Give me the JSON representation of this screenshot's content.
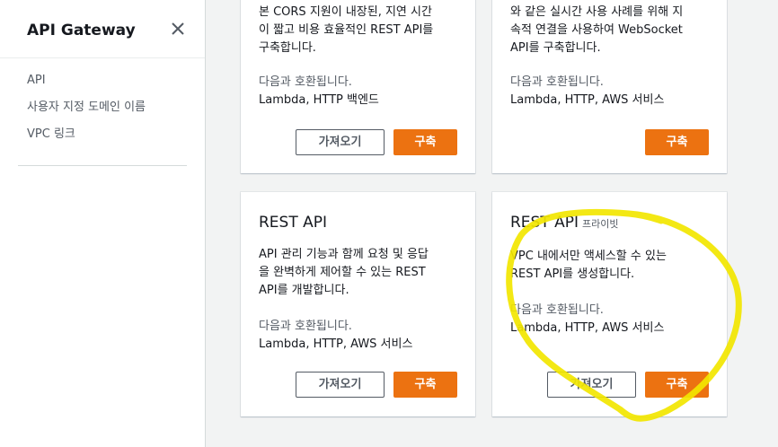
{
  "sidebar": {
    "title": "API Gateway",
    "close_icon": "close-icon",
    "items": [
      {
        "label": "API"
      },
      {
        "label": "사용자 지정 도메인 이름"
      },
      {
        "label": "VPC 링크"
      }
    ]
  },
  "cards": {
    "http_api": {
      "desc_lines": [
        "본 CORS 지원이 내장된, 지연 시간",
        "이 짧고 비용 효율적인 REST API를",
        "구축합니다."
      ],
      "compat_label": "다음과 호환됩니다.",
      "compat_value": "Lambda, HTTP 백엔드",
      "import_label": "가져오기",
      "build_label": "구축"
    },
    "websocket_api": {
      "desc_lines": [
        "와 같은 실시간 사용 사례를 위해 지",
        "속적 연결을 사용하여 WebSocket",
        "API를 구축합니다."
      ],
      "compat_label": "다음과 호환됩니다.",
      "compat_value": "Lambda, HTTP, AWS 서비스",
      "build_label": "구축"
    },
    "rest_api": {
      "title": "REST API",
      "desc_lines": [
        "API 관리 기능과 함께 요청 및 응답",
        "을 완벽하게 제어할 수 있는 REST",
        "API를 개발합니다."
      ],
      "compat_label": "다음과 호환됩니다.",
      "compat_value": "Lambda, HTTP, AWS 서비스",
      "import_label": "가져오기",
      "build_label": "구축"
    },
    "rest_api_private": {
      "title": "REST API",
      "badge": "프라이빗",
      "desc_lines": [
        "VPC 내에서만 액세스할 수 있는",
        "REST API를 생성합니다."
      ],
      "compat_label": "다음과 호환됩니다.",
      "compat_value": "Lambda, HTTP, AWS 서비스",
      "import_label": "가져오기",
      "build_label": "구축"
    }
  },
  "colors": {
    "primary": "#ec7211",
    "annotation": "#f2e600",
    "background": "#f2f3f3"
  }
}
